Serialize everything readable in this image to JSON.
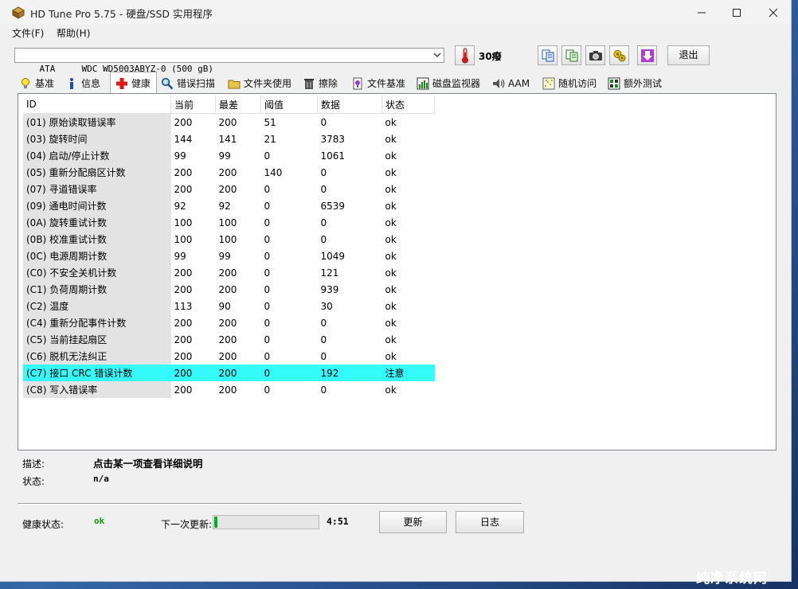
{
  "window": {
    "title": "HD Tune Pro 5.75 - 硬盘/SSD 实用程序"
  },
  "menu": [
    "文件(F)",
    "帮助(H)"
  ],
  "toolbar": {
    "drive": "ATA     WDC WD5003ABYZ-0 (500 gB)",
    "temperature": "30癈",
    "exit_label": "退出"
  },
  "tabs": [
    {
      "label": "基准",
      "icon": "lightbulb-icon"
    },
    {
      "label": "信息",
      "icon": "info-icon"
    },
    {
      "label": "健康",
      "icon": "health-cross-icon",
      "active": true
    },
    {
      "label": "错误扫描",
      "icon": "magnifier-icon"
    },
    {
      "label": "文件夹使用",
      "icon": "folder-icon"
    },
    {
      "label": "擦除",
      "icon": "trash-icon"
    },
    {
      "label": "文件基准",
      "icon": "file-benchmark-icon"
    },
    {
      "label": "磁盘监视器",
      "icon": "disk-monitor-icon"
    },
    {
      "label": "AAM",
      "icon": "speaker-icon"
    },
    {
      "label": "随机访问",
      "icon": "random-access-icon"
    },
    {
      "label": "额外测试",
      "icon": "extra-tests-icon"
    }
  ],
  "table": {
    "headers": [
      "ID",
      "当前",
      "最差",
      "阈值",
      "数据",
      "状态"
    ],
    "rows": [
      [
        "(01) 原始读取错误率",
        "200",
        "200",
        "51",
        "0",
        "ok"
      ],
      [
        "(03) 旋转时间",
        "144",
        "141",
        "21",
        "3783",
        "ok"
      ],
      [
        "(04) 启动/停止计数",
        "99",
        "99",
        "0",
        "1061",
        "ok"
      ],
      [
        "(05) 重新分配扇区计数",
        "200",
        "200",
        "140",
        "0",
        "ok"
      ],
      [
        "(07) 寻道错误率",
        "200",
        "200",
        "0",
        "0",
        "ok"
      ],
      [
        "(09) 通电时间计数",
        "92",
        "92",
        "0",
        "6539",
        "ok"
      ],
      [
        "(0A) 旋转重试计数",
        "100",
        "100",
        "0",
        "0",
        "ok"
      ],
      [
        "(0B) 校准重试计数",
        "100",
        "100",
        "0",
        "0",
        "ok"
      ],
      [
        "(0C) 电源周期计数",
        "99",
        "99",
        "0",
        "1049",
        "ok"
      ],
      [
        "(C0) 不安全关机计数",
        "200",
        "200",
        "0",
        "121",
        "ok"
      ],
      [
        "(C1) 负荷周期计数",
        "200",
        "200",
        "0",
        "939",
        "ok"
      ],
      [
        "(C2) 温度",
        "113",
        "90",
        "0",
        "30",
        "ok"
      ],
      [
        "(C4) 重新分配事件计数",
        "200",
        "200",
        "0",
        "0",
        "ok"
      ],
      [
        "(C5) 当前挂起扇区",
        "200",
        "200",
        "0",
        "0",
        "ok"
      ],
      [
        "(C6) 脱机无法纠正",
        "200",
        "200",
        "0",
        "0",
        "ok"
      ],
      [
        "(C7) 接口 CRC 错误计数",
        "200",
        "200",
        "0",
        "192",
        "注意"
      ],
      [
        "(C8) 写入错误率",
        "200",
        "200",
        "0",
        "0",
        "ok"
      ]
    ],
    "highlight_row": 15,
    "highlight_color": "#36fbfc"
  },
  "details": {
    "description_label": "描述:",
    "description_value": "点击某一项查看详细说明",
    "status_label": "状态:",
    "status_value": "n/a"
  },
  "footer": {
    "health_label": "健康状态:",
    "health_value": "ok",
    "next_update_label": "下一次更新:",
    "next_update_progress": 0.03,
    "next_update_time": "4:51",
    "refresh_label": "更新",
    "log_label": "日志"
  },
  "watermark": "纯净系统网",
  "colors": {
    "ok": "#0a9a0a",
    "progress": "#06b025"
  }
}
